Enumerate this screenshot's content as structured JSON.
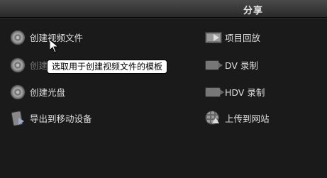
{
  "header": {
    "title": "分享"
  },
  "left_items": [
    {
      "label": "创建视频文件",
      "icon": "film-disc-icon"
    },
    {
      "label": "创建",
      "icon": "disc-icon"
    },
    {
      "label": "创建光盘",
      "icon": "disc-icon"
    },
    {
      "label": "导出到移动设备",
      "icon": "mobile-device-icon"
    }
  ],
  "right_items": [
    {
      "label": "项目回放",
      "icon": "project-playback-icon"
    },
    {
      "label": "DV 录制",
      "icon": "dv-camera-icon"
    },
    {
      "label": "HDV 录制",
      "icon": "hdv-camera-icon"
    },
    {
      "label": "上传到网站",
      "icon": "upload-web-icon"
    }
  ],
  "tooltip": {
    "text": "选取用于创建视频文件的模板"
  }
}
